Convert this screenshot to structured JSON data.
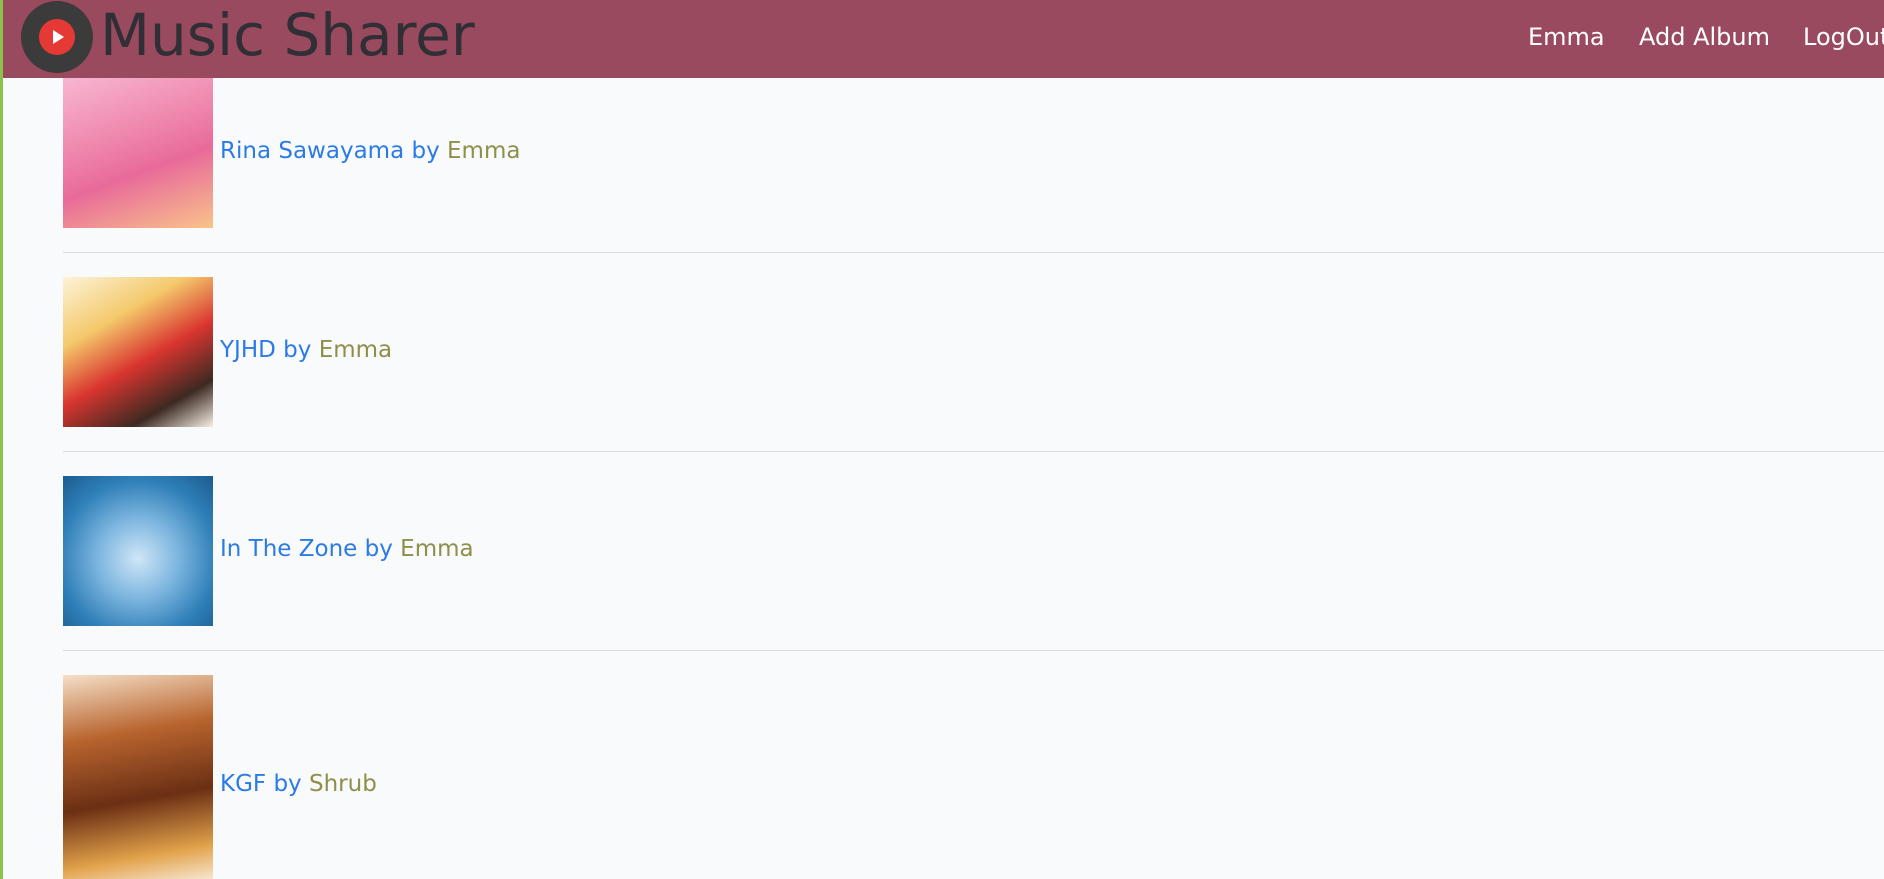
{
  "header": {
    "app_title": "Music Sharer",
    "logo_icon": "play-button-icon",
    "nav": {
      "user": "Emma",
      "add_album": "Add Album",
      "logout": "LogOut"
    },
    "colors": {
      "navbar_bg": "#9a4a5e",
      "logo_red": "#e53935"
    }
  },
  "albums": [
    {
      "title": "Rina Sawayama",
      "by": "by",
      "owner": "Emma"
    },
    {
      "title": "YJHD",
      "by": "by",
      "owner": "Emma"
    },
    {
      "title": "In The Zone",
      "by": "by",
      "owner": "Emma"
    },
    {
      "title": "KGF",
      "by": "by",
      "owner": "Shrub"
    }
  ],
  "colors": {
    "album_link": "#2c7be5",
    "owner_link": "#8f8f4a",
    "page_bg": "#f8fafc"
  }
}
